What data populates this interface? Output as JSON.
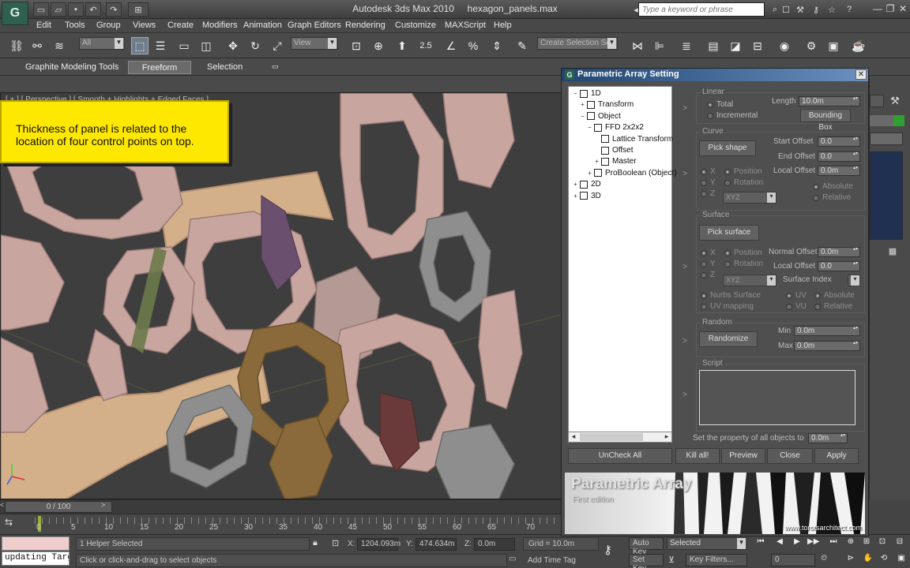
{
  "window": {
    "app_name": "Autodesk 3ds Max  2010",
    "file_name": "hexagon_panels.max",
    "search_placeholder": "Type a keyword or phrase"
  },
  "menu": [
    "Edit",
    "Tools",
    "Group",
    "Views",
    "Create",
    "Modifiers",
    "Animation",
    "Graph Editors",
    "Rendering",
    "Customize",
    "MAXScript",
    "Help"
  ],
  "toolbar": {
    "selection_filter": "All",
    "ref_coord": "View",
    "snap_angle": "2.5",
    "named_selection": "Create Selection Se"
  },
  "ribbon": {
    "tabs": [
      "Graphite Modeling Tools",
      "Freeform",
      "Selection"
    ],
    "active_tab": "Freeform"
  },
  "viewport": {
    "label": "[ + ] [ Perspective ] [ Smooth + Highlights + Edged Faces ]"
  },
  "callout": {
    "text": "Thickness of panel is related to the location of four control points on top."
  },
  "dialog": {
    "title": "Parametric Array Setting",
    "tree": [
      {
        "label": "1D",
        "indent": 0,
        "exp": "−"
      },
      {
        "label": "Transform",
        "indent": 1,
        "exp": "+"
      },
      {
        "label": "Object",
        "indent": 1,
        "exp": "−"
      },
      {
        "label": "FFD 2x2x2",
        "indent": 2,
        "exp": "−"
      },
      {
        "label": "Lattice Transform",
        "indent": 3,
        "exp": ""
      },
      {
        "label": "Offset",
        "indent": 3,
        "exp": ""
      },
      {
        "label": "Master",
        "indent": 3,
        "exp": "+"
      },
      {
        "label": "ProBoolean (Object)",
        "indent": 2,
        "exp": "+"
      },
      {
        "label": "2D",
        "indent": 0,
        "exp": "+"
      },
      {
        "label": "3D",
        "indent": 0,
        "exp": "+"
      }
    ],
    "linear": {
      "title": "Linear",
      "total": "Total",
      "incremental": "Incremental",
      "length_label": "Length",
      "length_value": "10.0m",
      "bounding_box": "Bounding Box"
    },
    "curve": {
      "title": "Curve",
      "pick_shape": "Pick shape",
      "start_offset_label": "Start Offset",
      "start_offset": "0.0",
      "end_offset_label": "End Offset",
      "end_offset": "0.0",
      "local_offset_label": "Local Offset",
      "local_offset": "0.0m",
      "x": "X",
      "y": "Y",
      "z": "Z",
      "position": "Position",
      "rotation": "Rotation",
      "axis": "XYZ",
      "absolute": "Absolute",
      "relative": "Relative"
    },
    "surface": {
      "title": "Surface",
      "pick_surface": "Pick surface",
      "normal_offset_label": "Normal Offset",
      "normal_offset": "0.0m",
      "local_offset_label": "Local Offset",
      "local_offset": "0.0",
      "surface_index_label": "Surface Index",
      "x": "X",
      "y": "Y",
      "z": "Z",
      "position": "Position",
      "rotation": "Rotation",
      "axis": "XYZ",
      "nurbs": "Nurbs Surface",
      "uv_mapping": "UV mapping",
      "uv": "UV",
      "vu": "VU",
      "absolute": "Absolute",
      "relative": "Relative"
    },
    "random": {
      "title": "Random",
      "randomize": "Randomize",
      "min_label": "Min",
      "min": "0.0m",
      "max_label": "Max",
      "max": "0.0m"
    },
    "script": {
      "title": "Script"
    },
    "set_property_label": "Set the property of all objects to",
    "set_property_value": "0.0m",
    "buttons": {
      "uncheck_all": "UnCheck All",
      "kill_all": "Kill all!",
      "preview": "Preview",
      "close": "Close",
      "apply": "Apply"
    },
    "banner": {
      "title": "Parametric Array",
      "subtitle": "First edition",
      "site": "www.torotsarchitect.com"
    }
  },
  "timeline": {
    "frame": "0 / 100",
    "ticks": [
      "0",
      "5",
      "10",
      "15",
      "20",
      "25",
      "30",
      "35",
      "40",
      "45",
      "50",
      "55",
      "60",
      "65",
      "70"
    ]
  },
  "status": {
    "maxscript_listener": "updating Targ",
    "selection": "1 Helper Selected",
    "prompt": "Click or click-and-drag to select objects",
    "x_label": "X:",
    "x": "1204.093m",
    "y_label": "Y:",
    "y": "474.634m",
    "z_label": "Z:",
    "z": "0.0m",
    "grid": "Grid = 10.0m",
    "add_time_tag": "Add Time Tag",
    "auto_key": "Auto Key",
    "set_key": "Set Key",
    "key_mode": "Selected",
    "key_filters": "Key Filters...",
    "frame_field": "0"
  },
  "colors": {
    "callout_bg": "#ffe800",
    "dialog_title_start": "#20456f",
    "dialog_title_end": "#6b8fbf",
    "panel_pink": "#c9a5a0",
    "panel_tan": "#d3af8a",
    "panel_brown": "#8a6a3a",
    "panel_purple": "#6b4f6f"
  }
}
